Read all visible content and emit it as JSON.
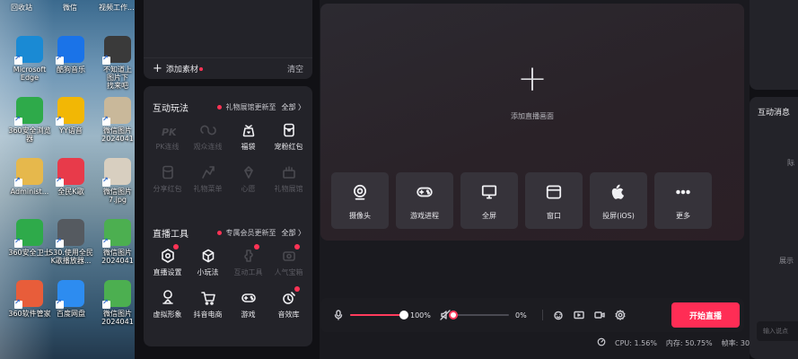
{
  "desktop": {
    "top_labels": [
      "回收站",
      "微信",
      "视频工作..."
    ],
    "icons": [
      {
        "label": "Microsoft\nEdge",
        "color": "#1a8ad4"
      },
      {
        "label": "酷狗音乐",
        "color": "#1a73e8"
      },
      {
        "label": "不知道上\n图片下\n找来吧",
        "color": "#3a3a3a"
      },
      {
        "label": "360安全浏览\n器",
        "color": "#2eaa4a"
      },
      {
        "label": "YY语音",
        "color": "#f2b705"
      },
      {
        "label": "微信图片\n2024041",
        "color": "#c9b89a"
      },
      {
        "label": "Administ...",
        "color": "#e6b84c"
      },
      {
        "label": "全民K歌",
        "color": "#e83a4a"
      },
      {
        "label": "微信图片\n7.jpg",
        "color": "#d8cfc0"
      },
      {
        "label": "360安全卫士",
        "color": "#2eaa4a"
      },
      {
        "label": "S30.使用全民\nK歌播放器...",
        "color": "#555a60"
      },
      {
        "label": "微信图片\n2024041",
        "color": "#4caf50"
      },
      {
        "label": "360软件管家",
        "color": "#e85d3a"
      },
      {
        "label": "百度网盘",
        "color": "#2d8cf0"
      },
      {
        "label": "微信图片\n2024041",
        "color": "#4caf50"
      }
    ]
  },
  "material": {
    "add_label": "添加素材",
    "clear_label": "清空"
  },
  "interactive": {
    "title": "互动玩法",
    "notice": "礼物展馆更新至",
    "all_label": "全部 〉",
    "items": [
      {
        "label": "PK连线",
        "icon": "pk-icon",
        "dim": true
      },
      {
        "label": "观众连线",
        "icon": "audience-link-icon",
        "dim": true
      },
      {
        "label": "福袋",
        "icon": "lucky-bag-icon",
        "dim": false
      },
      {
        "label": "宠粉红包",
        "icon": "red-packet-icon",
        "dim": false
      },
      {
        "label": "分享红包",
        "icon": "share-packet-icon",
        "dim": true
      },
      {
        "label": "礼物菜单",
        "icon": "gift-menu-icon",
        "dim": true
      },
      {
        "label": "心愿",
        "icon": "wish-icon",
        "dim": true
      },
      {
        "label": "礼物展馆",
        "icon": "gift-hall-icon",
        "dim": true
      }
    ]
  },
  "live_tools": {
    "title": "直播工具",
    "notice": "专属会员更新至",
    "all_label": "全部 〉",
    "items": [
      {
        "label": "直播设置",
        "icon": "live-settings-icon",
        "dim": false,
        "badge": true
      },
      {
        "label": "小玩法",
        "icon": "mini-game-icon",
        "dim": false,
        "badge": false
      },
      {
        "label": "互动工具",
        "icon": "interactive-tools-icon",
        "dim": true,
        "badge": true
      },
      {
        "label": "人气宝箱",
        "icon": "treasure-box-icon",
        "dim": true,
        "badge": true
      },
      {
        "label": "虚拟形象",
        "icon": "avatar-icon",
        "dim": false,
        "badge": false
      },
      {
        "label": "抖音电商",
        "icon": "cart-icon",
        "dim": false,
        "badge": false
      },
      {
        "label": "游戏",
        "icon": "gamepad-icon",
        "dim": false,
        "badge": false
      },
      {
        "label": "音效库",
        "icon": "sound-effects-icon",
        "dim": false,
        "badge": true
      }
    ]
  },
  "preview": {
    "add_caption": "添加直播画面",
    "sources": [
      {
        "label": "摄像头",
        "icon": "camera-icon"
      },
      {
        "label": "游戏进程",
        "icon": "gamepad-icon"
      },
      {
        "label": "全屏",
        "icon": "monitor-icon"
      },
      {
        "label": "窗口",
        "icon": "window-icon"
      },
      {
        "label": "投屏(iOS)",
        "icon": "apple-icon"
      },
      {
        "label": "更多",
        "icon": "more-icon"
      }
    ]
  },
  "controls": {
    "mic_volume": 100,
    "mic_volume_label": "100%",
    "speaker_volume": 0,
    "speaker_volume_label": "0%",
    "start_live_label": "开始直播"
  },
  "status": {
    "cpu": "CPU: 1.56%",
    "memory": "内存: 50.75%",
    "fps": "帧率: 30"
  },
  "right_panel": {
    "title": "互动消息",
    "frag1": "际",
    "frag2": "展示",
    "input_placeholder": "输入说点"
  },
  "colors": {
    "accent": "#ff2d55",
    "panel": "#232329",
    "background": "#111115"
  }
}
